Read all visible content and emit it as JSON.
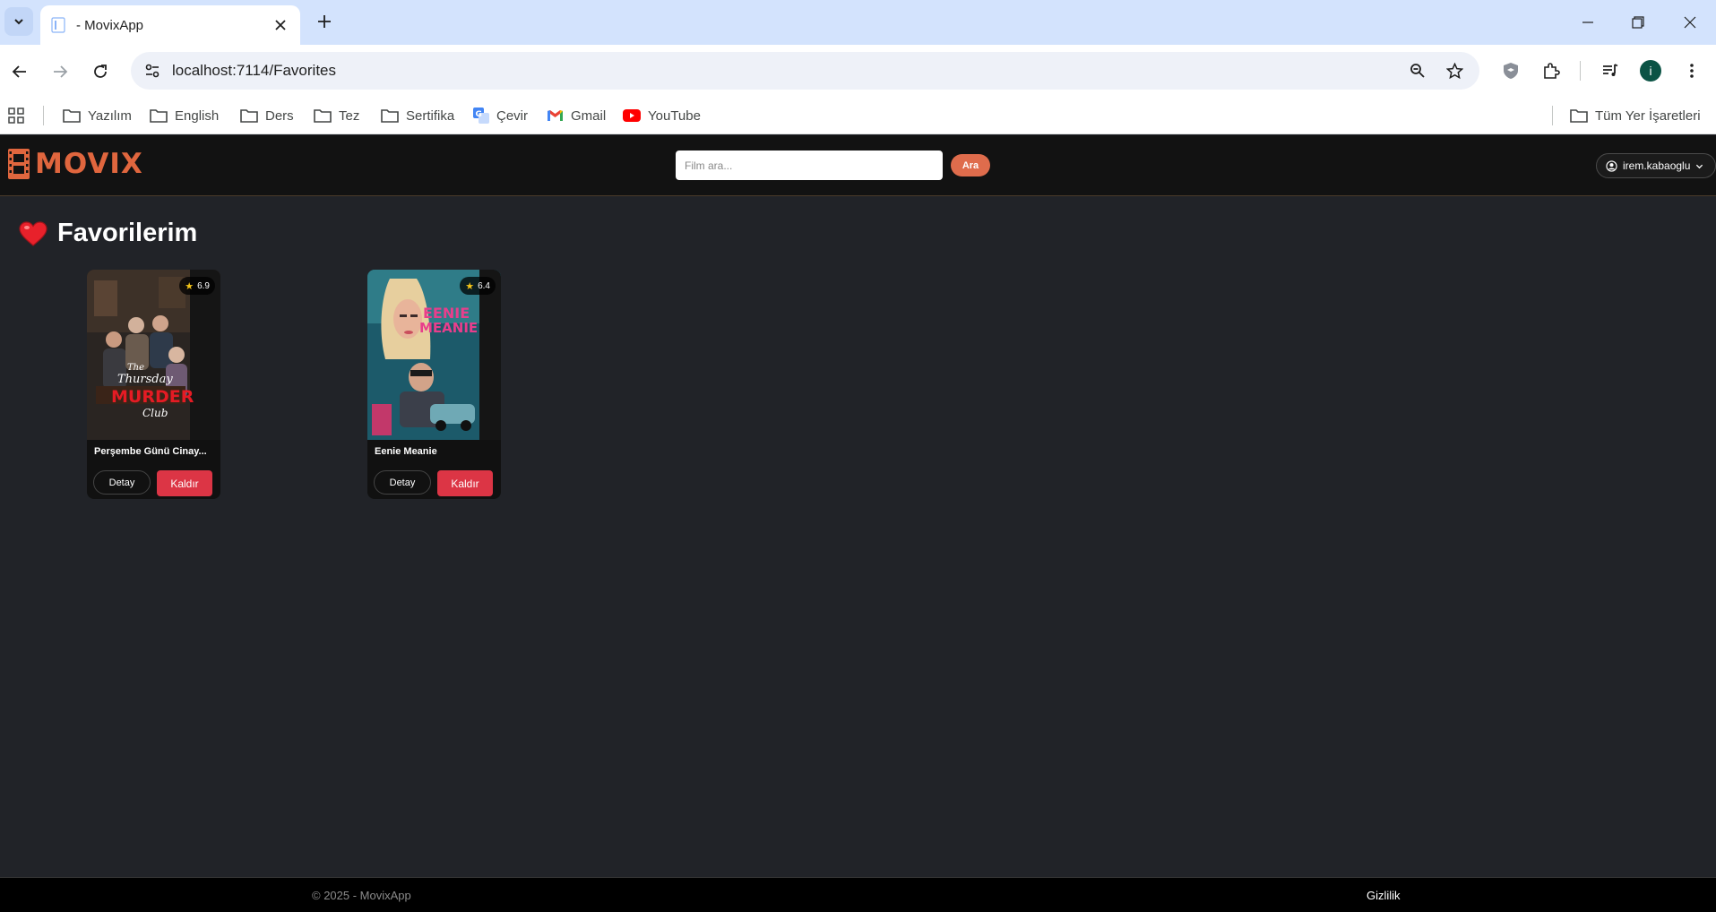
{
  "browser": {
    "tab_title": "- MovixApp",
    "url": "localhost:7114/Favorites",
    "profile_initial": "i",
    "bookmarks": [
      "Yazılım",
      "English",
      "Ders",
      "Tez",
      "Sertifika",
      "Çevir",
      "Gmail",
      "YouTube"
    ],
    "all_bookmarks": "Tüm Yer İşaretleri"
  },
  "site": {
    "brand": "MOVIX",
    "brand_color": "#e0663e",
    "search_placeholder": "Film ara...",
    "search_button": "Ara",
    "username": "irem.kabaoglu"
  },
  "page": {
    "title": "Favorilerim"
  },
  "favorites": [
    {
      "title": "Perşembe Günü Cinay...",
      "rating": "6.9",
      "poster_text": [
        "The",
        "Thursday",
        "MURDER",
        "Club"
      ],
      "detail_label": "Detay",
      "remove_label": "Kaldır"
    },
    {
      "title": "Eenie Meanie",
      "rating": "6.4",
      "poster_text": [
        "EENIE",
        "MEANIE"
      ],
      "detail_label": "Detay",
      "remove_label": "Kaldır"
    }
  ],
  "footer": {
    "copyright": "© 2025 - MovixApp",
    "privacy": "Gizlilik"
  }
}
